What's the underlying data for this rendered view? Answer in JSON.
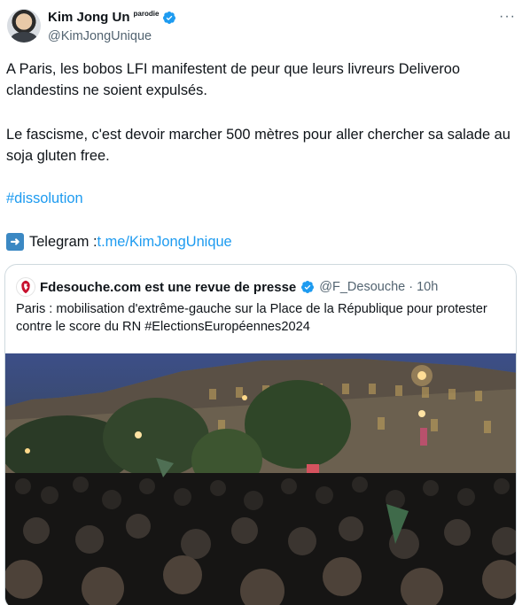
{
  "tweet": {
    "author_name": "Kim Jong Un",
    "parody_label": "parodie",
    "handle": "@KimJongUnique",
    "more_icon": "···",
    "paragraph1": "A Paris, les bobos LFI manifestent de peur que leurs livreurs Deliveroo clandestins ne soient expulsés.",
    "paragraph2": "Le fascisme, c'est devoir marcher 500 mètres pour aller chercher sa salade au soja gluten free.",
    "hashtag": "#dissolution",
    "telegram_label": "Telegram : ",
    "telegram_link": "t.me/KimJongUnique"
  },
  "quote": {
    "author_name": "Fdesouche.com est une revue de presse",
    "handle_time": "@F_Desouche · 10h",
    "text": "Paris : mobilisation d'extrême-gauche sur la Place de la République pour protester contre le score du RN  #ElectionsEuropéennes2024"
  },
  "colors": {
    "accent": "#1d9bf0",
    "verified": "#1d9bf0",
    "secondary_text": "#536471",
    "border": "#cfd9de"
  }
}
